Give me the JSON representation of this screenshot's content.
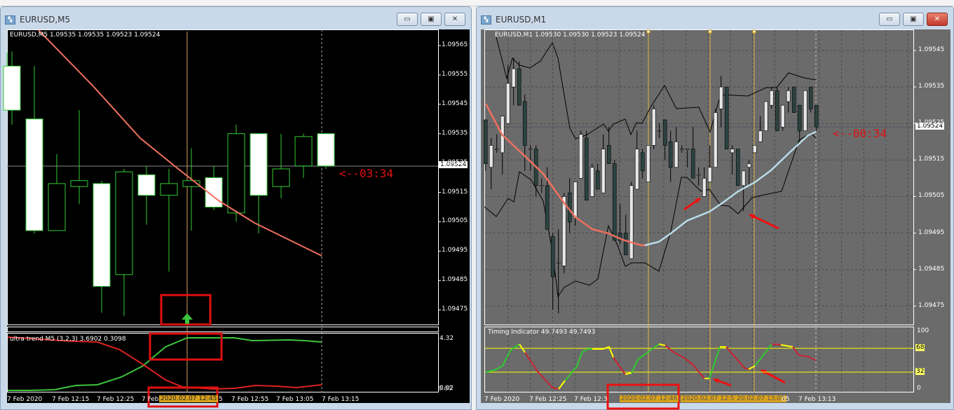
{
  "left_window": {
    "title": "EURUSD,M5",
    "buttons": {
      "minimize": "▭",
      "restore": "▣",
      "close": "✕"
    },
    "info": "EURUSD,M5  1.09535 1.09535 1.09523 1.09524",
    "countdown": "<--03:34",
    "current_price": "1.09524",
    "price_ticks": [
      "1.09565",
      "1.09555",
      "1.09545",
      "1.09535",
      "1.09525",
      "1.09515",
      "1.09505",
      "1.09495",
      "1.09485",
      "1.09475"
    ],
    "indicator_label": "ultra trend M5 (3,2,3) 3.6902 0.3098",
    "indicator_ticks": [
      "4.32",
      "0.02",
      "0.00"
    ],
    "time_labels": [
      "7 Feb 2020",
      "7 Feb 12:15",
      "7 Feb 12:25",
      "7 Feb",
      "5",
      "7 Feb 12:55",
      "7 Feb 13:05",
      "7 Feb 13:15"
    ],
    "time_highlight": "2020.02.07 12:45",
    "signal_icon": "up-arrow-icon",
    "colors": {
      "bg": "#000000",
      "candle": "#33cc33",
      "ma": "#f07060",
      "bull_line": "#3cc43c",
      "bear_line": "#dd2222",
      "marker": "#e01010"
    },
    "candles": [
      [
        1.09558,
        1.09563,
        1.09538,
        1.09543
      ],
      [
        1.0954,
        1.09558,
        1.09501,
        1.09502
      ],
      [
        1.09502,
        1.09528,
        1.09502,
        1.09518
      ],
      [
        1.09517,
        1.09543,
        1.09511,
        1.09519
      ],
      [
        1.09518,
        1.09519,
        1.09474,
        1.09483
      ],
      [
        1.09487,
        1.09523,
        1.09473,
        1.09522
      ],
      [
        1.09521,
        1.09524,
        1.09504,
        1.09514
      ],
      [
        1.09514,
        1.09523,
        1.09488,
        1.09518
      ],
      [
        1.09517,
        1.0953,
        1.09502,
        1.09519
      ],
      [
        1.0952,
        1.09524,
        1.09509,
        1.0951
      ],
      [
        1.09508,
        1.09538,
        1.09505,
        1.09535
      ],
      [
        1.09535,
        1.09535,
        1.09501,
        1.09514
      ],
      [
        1.09517,
        1.09535,
        1.09513,
        1.09523
      ],
      [
        1.09524,
        1.09535,
        1.0952,
        1.09534
      ],
      [
        1.09535,
        1.09535,
        1.09523,
        1.09524
      ]
    ]
  },
  "right_window": {
    "title": "EURUSD,M1",
    "buttons": {
      "minimize": "▭",
      "restore": "▣",
      "close": "✕"
    },
    "info": "EURUSD,M1  1.09530 1.09530 1.09523 1.09524",
    "countdown": "<--00:34",
    "current_price": "1.09524",
    "price_ticks": [
      "1.09545",
      "1.09535",
      "1.09525",
      "1.09515",
      "1.09505",
      "1.09495",
      "1.09485",
      "1.09475"
    ],
    "indicator_label": "Timing Indicator 49.7493 49.7493",
    "indicator_ticks": [
      "100",
      "68",
      "32",
      "0"
    ],
    "time_labels": [
      "7 Feb 2020",
      "7 Feb 12:25",
      "7 Feb 12:3",
      "05",
      "7 Feb 13:13"
    ],
    "time_highlights": [
      "2020.02.07 12:46",
      "2020.02.07 12:57",
      "20.02.07 13:05"
    ],
    "colors": {
      "bg": "#6b6b6b",
      "bull": "#e8e8e8",
      "bear": "#2c4340",
      "ma_down": "#f07060",
      "ma_up": "#b8dce8",
      "level": "#ffff00",
      "marker": "#ee1111"
    },
    "candles": [
      [
        1.09526,
        1.09526,
        1.09512,
        1.09514
      ],
      [
        1.09513,
        1.09521,
        1.09507,
        1.09519
      ],
      [
        1.09518,
        1.09522,
        1.09517,
        1.09518
      ],
      [
        1.09517,
        1.09527,
        1.09511,
        1.09527
      ],
      [
        1.09525,
        1.09541,
        1.09525,
        1.09536
      ],
      [
        1.09535,
        1.09543,
        1.0953,
        1.0954
      ],
      [
        1.0954,
        1.09542,
        1.0953,
        1.0953
      ],
      [
        1.09531,
        1.09533,
        1.09512,
        1.09519
      ],
      [
        1.09518,
        1.09519,
        1.09512,
        1.09518
      ],
      [
        1.09518,
        1.09519,
        1.09505,
        1.09508
      ],
      [
        1.09508,
        1.0951,
        1.09506,
        1.09508
      ],
      [
        1.09508,
        1.09513,
        1.09496,
        1.09496
      ],
      [
        1.09494,
        1.09495,
        1.09474,
        1.09483
      ],
      [
        1.09487,
        1.09496,
        1.09473,
        1.09487
      ],
      [
        1.09486,
        1.09506,
        1.09484,
        1.09505
      ],
      [
        1.09506,
        1.0951,
        1.09495,
        1.09498
      ],
      [
        1.09499,
        1.09509,
        1.09497,
        1.09509
      ],
      [
        1.0951,
        1.09523,
        1.0951,
        1.09522
      ],
      [
        1.09521,
        1.09523,
        1.09504,
        1.09504
      ],
      [
        1.09505,
        1.09514,
        1.09505,
        1.09513
      ],
      [
        1.09512,
        1.09514,
        1.09507,
        1.09507
      ],
      [
        1.09506,
        1.09522,
        1.09506,
        1.09518
      ],
      [
        1.09519,
        1.09524,
        1.09514,
        1.09514
      ],
      [
        1.09514,
        1.09515,
        1.09493,
        1.09493
      ],
      [
        1.09495,
        1.09503,
        1.09492,
        1.09493
      ],
      [
        1.09495,
        1.095,
        1.09489,
        1.09489
      ],
      [
        1.09488,
        1.09509,
        1.09488,
        1.09508
      ],
      [
        1.09507,
        1.09523,
        1.09507,
        1.09518
      ],
      [
        1.09517,
        1.09518,
        1.0951,
        1.09512
      ],
      [
        1.09509,
        1.09519,
        1.09509,
        1.09519
      ],
      [
        1.09519,
        1.0953,
        1.09518,
        1.09529
      ],
      [
        1.09523,
        1.09525,
        1.09521,
        1.09523
      ],
      [
        1.09526,
        1.09526,
        1.09515,
        1.09519
      ],
      [
        1.0952,
        1.09523,
        1.09509,
        1.09513
      ],
      [
        1.09513,
        1.09524,
        1.09513,
        1.0952
      ],
      [
        1.09518,
        1.09519,
        1.09517,
        1.09518
      ],
      [
        1.09518,
        1.09518,
        1.09513,
        1.09518
      ],
      [
        1.09518,
        1.09524,
        1.0951,
        1.0951
      ],
      [
        1.09511,
        1.09513,
        1.09508,
        1.09511
      ],
      [
        1.09505,
        1.09513,
        1.09505,
        1.0951
      ],
      [
        1.09509,
        1.09519,
        1.09509,
        1.09513
      ],
      [
        1.09513,
        1.09529,
        1.09513,
        1.09528
      ],
      [
        1.09529,
        1.09538,
        1.09524,
        1.09535
      ],
      [
        1.09535,
        1.09535,
        1.09518,
        1.09518
      ],
      [
        1.09517,
        1.09519,
        1.09511,
        1.09518
      ],
      [
        1.09518,
        1.09518,
        1.09508,
        1.09508
      ],
      [
        1.09508,
        1.09512,
        1.09501,
        1.09512
      ],
      [
        1.09513,
        1.09515,
        1.09508,
        1.09514
      ],
      [
        1.09517,
        1.09519,
        1.09517,
        1.09519
      ],
      [
        1.0952,
        1.09527,
        1.0952,
        1.09523
      ],
      [
        1.09523,
        1.09531,
        1.09523,
        1.09531
      ],
      [
        1.0953,
        1.09535,
        1.09529,
        1.09534
      ],
      [
        1.09534,
        1.09535,
        1.09523,
        1.09523
      ],
      [
        1.09524,
        1.0953,
        1.09523,
        1.0953
      ],
      [
        1.09531,
        1.09535,
        1.09528,
        1.09534
      ],
      [
        1.09535,
        1.09535,
        1.09528,
        1.09528
      ],
      [
        1.0953,
        1.0953,
        1.0952,
        1.09523
      ],
      [
        1.09523,
        1.09534,
        1.09523,
        1.09534
      ],
      [
        1.09535,
        1.09535,
        1.09528,
        1.09529
      ],
      [
        1.0953,
        1.0953,
        1.09523,
        1.09524
      ]
    ]
  }
}
